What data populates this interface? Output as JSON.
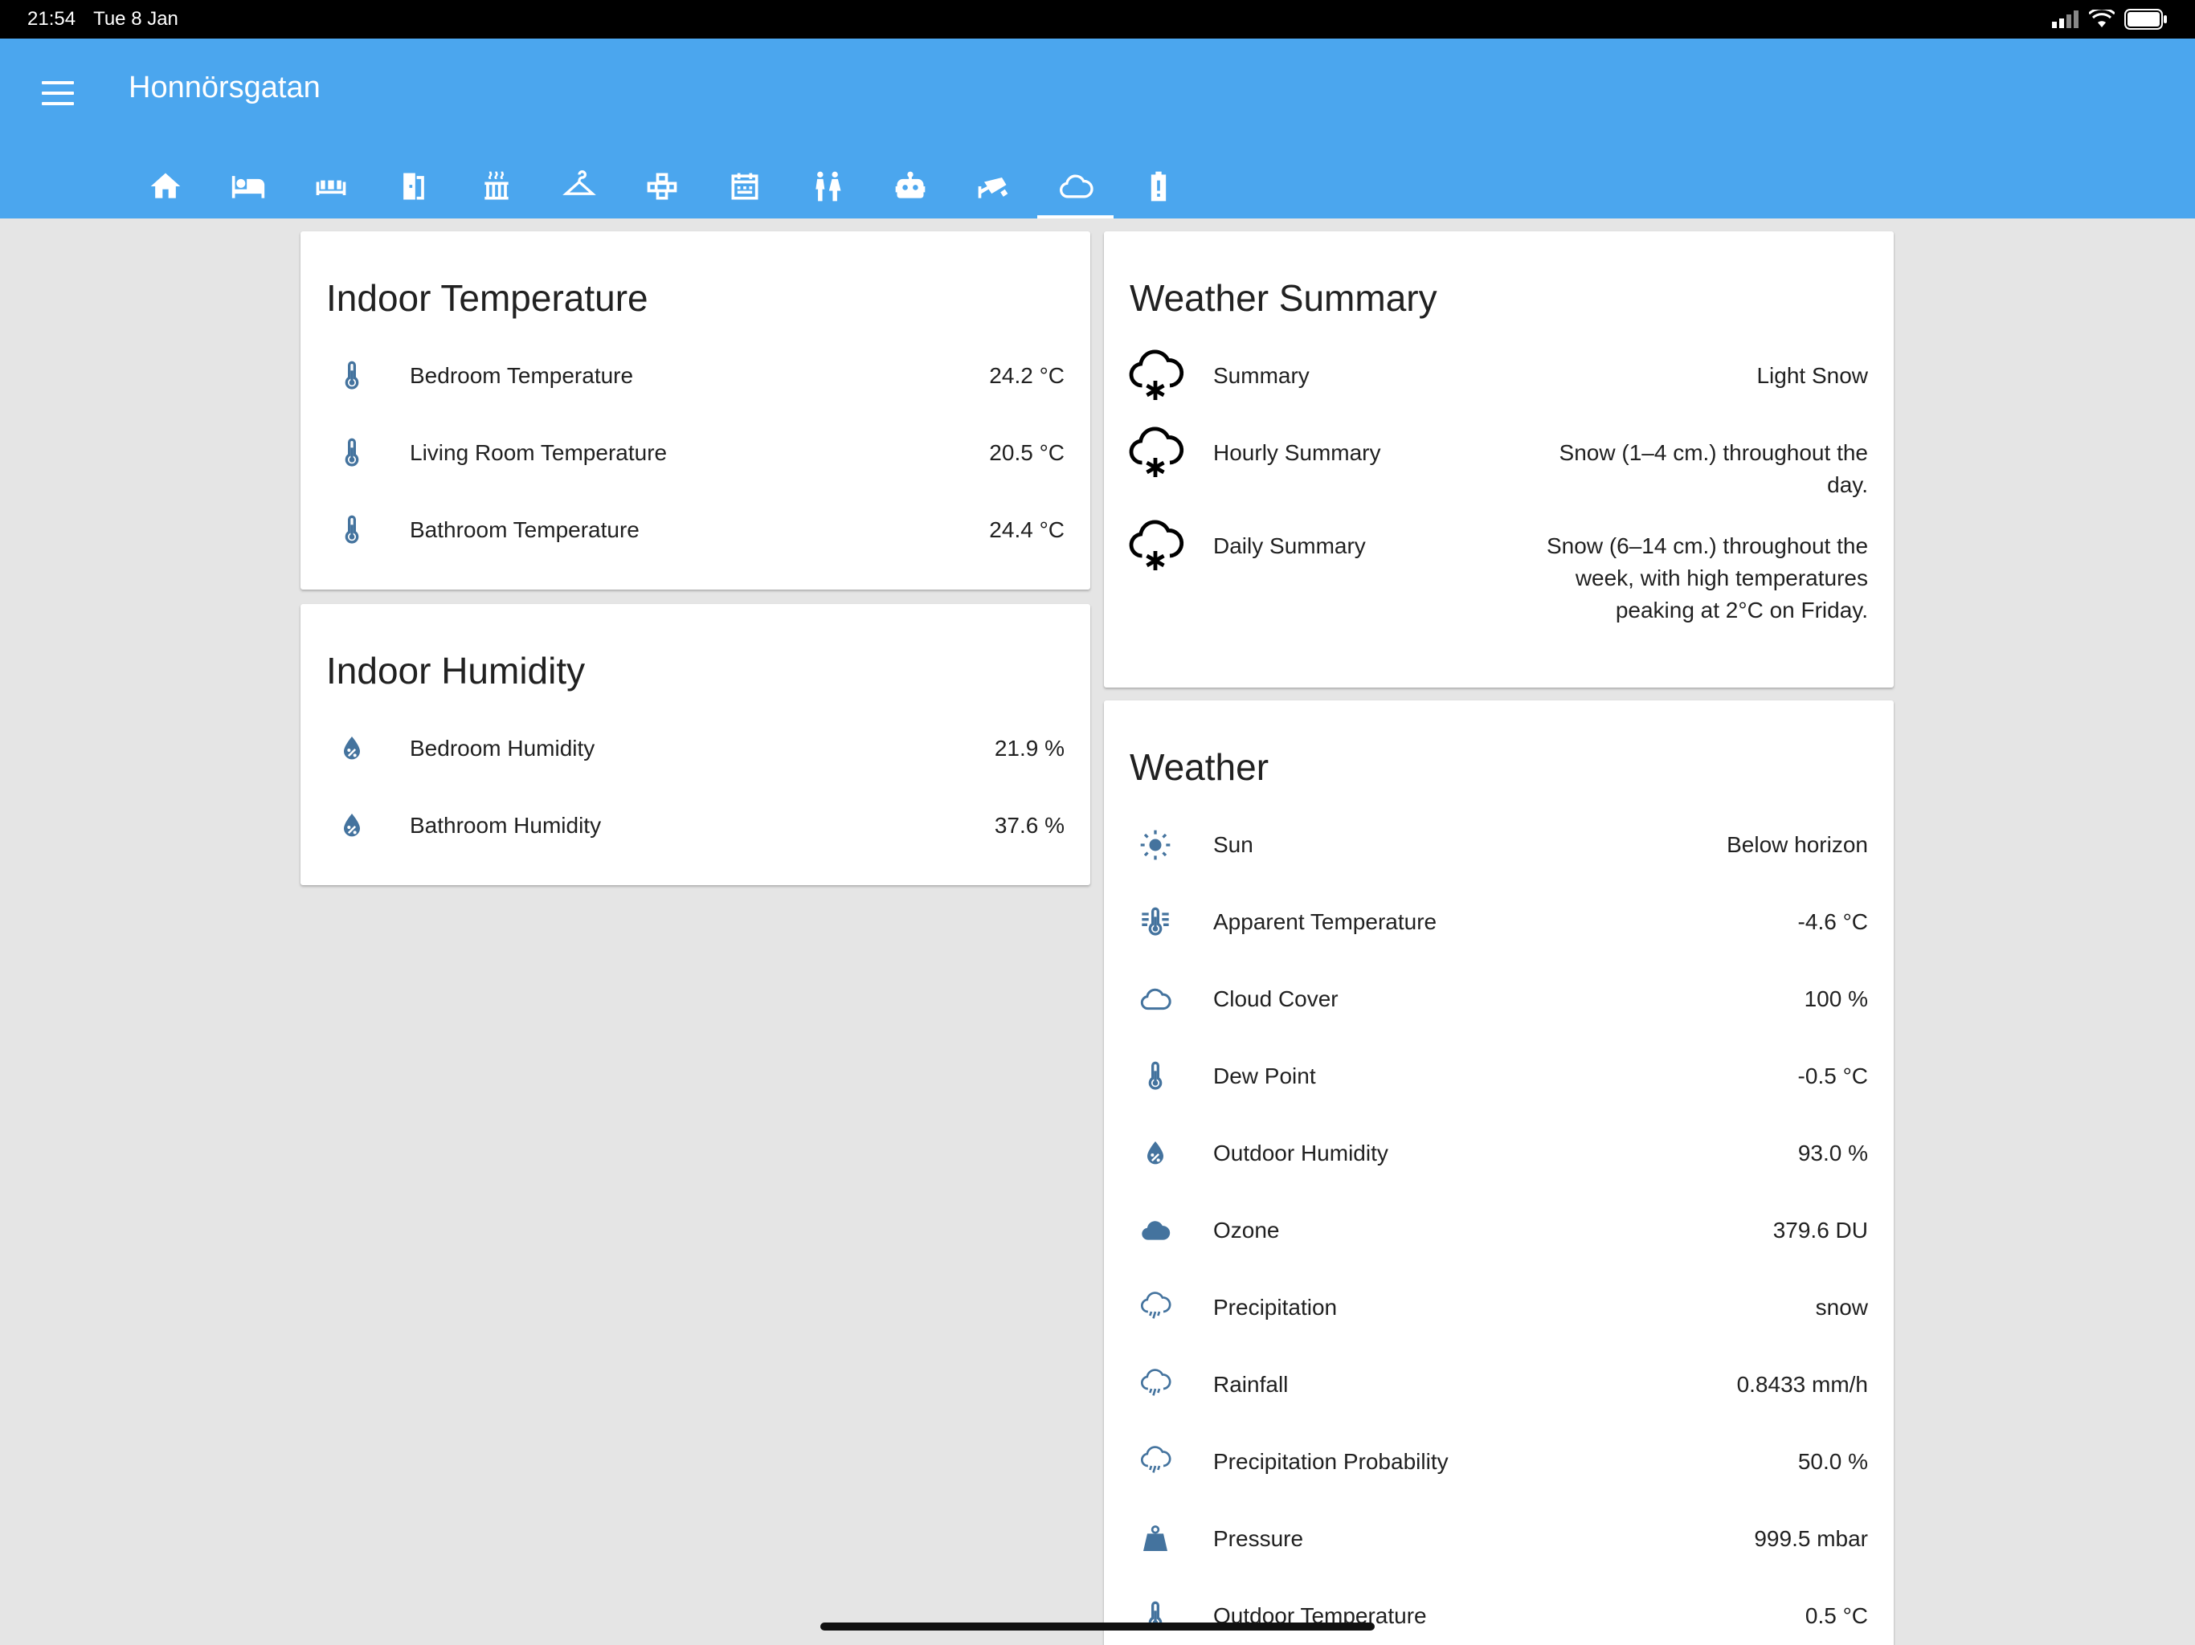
{
  "status": {
    "time": "21:54",
    "date": "Tue 8 Jan"
  },
  "header": {
    "title": "Honnörsgatan",
    "tabs": [
      {
        "icon": "home-icon"
      },
      {
        "icon": "bed-icon"
      },
      {
        "icon": "sofa-icon"
      },
      {
        "icon": "door-icon"
      },
      {
        "icon": "radiator-icon"
      },
      {
        "icon": "hanger-icon"
      },
      {
        "icon": "network-icon"
      },
      {
        "icon": "calendar-icon"
      },
      {
        "icon": "people-icon"
      },
      {
        "icon": "robot-icon"
      },
      {
        "icon": "cctv-icon"
      },
      {
        "icon": "cloud-icon",
        "active": true
      },
      {
        "icon": "battery-alert-icon"
      }
    ]
  },
  "indoor_temperature": {
    "title": "Indoor Temperature",
    "rows": [
      {
        "label": "Bedroom Temperature",
        "value": "24.2 °C"
      },
      {
        "label": "Living Room Temperature",
        "value": "20.5 °C"
      },
      {
        "label": "Bathroom Temperature",
        "value": "24.4 °C"
      }
    ]
  },
  "indoor_humidity": {
    "title": "Indoor Humidity",
    "rows": [
      {
        "label": "Bedroom Humidity",
        "value": "21.9 %"
      },
      {
        "label": "Bathroom Humidity",
        "value": "37.6 %"
      }
    ]
  },
  "weather_summary": {
    "title": "Weather Summary",
    "rows": [
      {
        "label": "Summary",
        "value": "Light Snow"
      },
      {
        "label": "Hourly Summary",
        "value": "Snow (1–4 cm.) throughout the day."
      },
      {
        "label": "Daily Summary",
        "value": "Snow (6–14 cm.) throughout the week, with high temperatures peaking at 2°C on Friday."
      }
    ]
  },
  "weather": {
    "title": "Weather",
    "rows": [
      {
        "label": "Sun",
        "value": "Below horizon",
        "icon": "sun-icon"
      },
      {
        "label": "Apparent Temperature",
        "value": "-4.6 °C",
        "icon": "thermometer-lines-icon"
      },
      {
        "label": "Cloud Cover",
        "value": "100 %",
        "icon": "cloud-outline-icon"
      },
      {
        "label": "Dew Point",
        "value": "-0.5 °C",
        "icon": "thermometer-icon"
      },
      {
        "label": "Outdoor Humidity",
        "value": "93.0 %",
        "icon": "water-percent-icon"
      },
      {
        "label": "Ozone",
        "value": "379.6 DU",
        "icon": "cloud-filled-icon"
      },
      {
        "label": "Precipitation",
        "value": "snow",
        "icon": "weather-rainy-icon"
      },
      {
        "label": "Rainfall",
        "value": "0.8433 mm/h",
        "icon": "weather-rainy-icon"
      },
      {
        "label": "Precipitation Probability",
        "value": "50.0 %",
        "icon": "weather-rainy-icon"
      },
      {
        "label": "Pressure",
        "value": "999.5 mbar",
        "icon": "weight-icon"
      },
      {
        "label": "Outdoor Temperature",
        "value": "0.5 °C",
        "icon": "thermometer-icon"
      }
    ]
  },
  "colors": {
    "header": "#4ba6ee",
    "icon": "#44739e",
    "background": "#e5e5e5"
  }
}
